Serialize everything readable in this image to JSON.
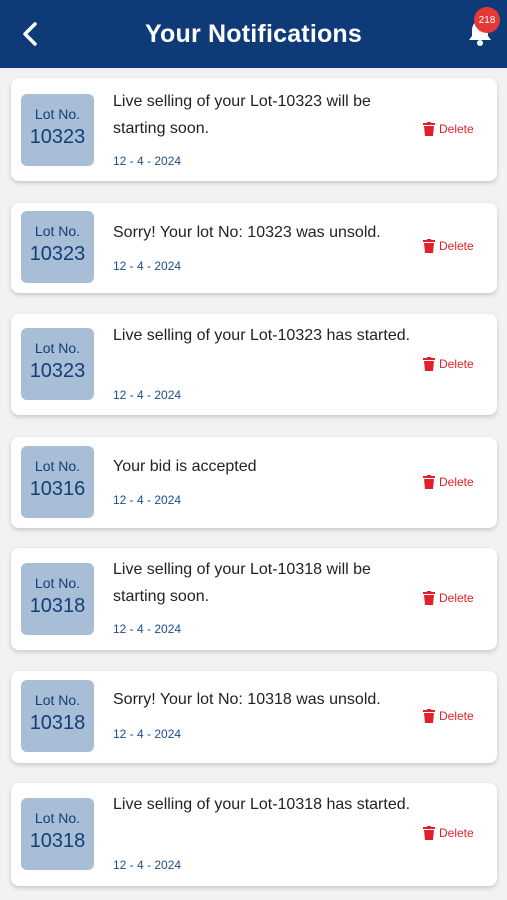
{
  "header": {
    "title": "Your Notifications",
    "notification_count": "218"
  },
  "notifications": [
    {
      "lot_label": "Lot No.",
      "lot_number": "10323",
      "message": "Live selling of your Lot-10323 will be starting soon.",
      "date": "12 - 4 - 2024",
      "delete_label": "Delete"
    },
    {
      "lot_label": "Lot No.",
      "lot_number": "10323",
      "message": "Sorry! Your lot No: 10323 was unsold.",
      "date": "12 - 4 - 2024",
      "delete_label": "Delete"
    },
    {
      "lot_label": "Lot No.",
      "lot_number": "10323",
      "message": "Live selling of your Lot-10323 has started.",
      "date": "12 - 4 - 2024",
      "delete_label": "Delete"
    },
    {
      "lot_label": "Lot No.",
      "lot_number": "10316",
      "message": "Your bid is accepted",
      "date": "12 - 4 - 2024",
      "delete_label": "Delete"
    },
    {
      "lot_label": "Lot No.",
      "lot_number": "10318",
      "message": "Live selling of your Lot-10318 will be starting soon.",
      "date": "12 - 4 - 2024",
      "delete_label": "Delete"
    },
    {
      "lot_label": "Lot No.",
      "lot_number": "10318",
      "message": "Sorry! Your lot No: 10318 was unsold.",
      "date": "12 - 4 - 2024",
      "delete_label": "Delete"
    },
    {
      "lot_label": "Lot No.",
      "lot_number": "10318",
      "message": "Live selling of your Lot-10318 has started.",
      "date": "12 - 4 - 2024",
      "delete_label": "Delete"
    }
  ]
}
